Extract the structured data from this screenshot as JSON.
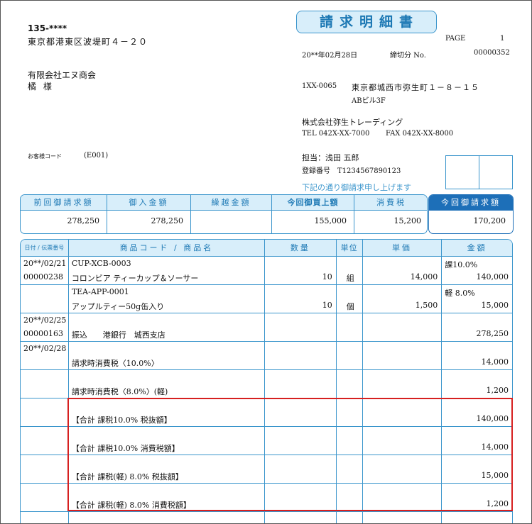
{
  "document": {
    "title": "請求明細書",
    "page_label": "PAGE",
    "page_number": "1",
    "date": "20**年02月28日",
    "cutoff_label": "締切分 No.",
    "doc_no": "00000352"
  },
  "recipient": {
    "postal": "135-****",
    "address": "東京都港東区波堤町４－２０",
    "company": "有限会社エヌ商会",
    "person": "橘 様",
    "customer_code_label": "お客様コード",
    "customer_code": "(E001)"
  },
  "issuer": {
    "postal": "1XX-0065",
    "address1": "東京都城西市弥生町１－８－１５",
    "address2": "ABビル3F",
    "company": "株式会社弥生トレーディング",
    "tel": "TEL 042X-XX-7000",
    "fax": "FAX 042X-XX-8000",
    "staff": "担当：浅田 五郎",
    "registration": "登録番号　T1234567890123",
    "note": "下記の通り御請求申し上げます"
  },
  "summary": {
    "prev_label": "前回御請求額",
    "prev": "278,250",
    "received_label": "御入金額",
    "received": "278,250",
    "carry_label": "繰越金額",
    "carry": "",
    "purchase_label": "今回御買上額",
    "purchase": "155,000",
    "tax_label": "消費税",
    "tax": "15,200",
    "total_label": "今回御請求額",
    "total": "170,200"
  },
  "table": {
    "headers": {
      "date": "日付 / 伝票番号",
      "product": "商品コード / 商品名",
      "qty": "数量",
      "unit": "単位",
      "price": "単価",
      "amount": "金額"
    },
    "rows": [
      {
        "date": "20**/02/21",
        "slip": "00000238",
        "code": "CUP-XCB-0003",
        "name": "コロンビア ティーカップ＆ソーサー",
        "qty": "10",
        "unit": "組",
        "price": "14,000",
        "tax_note": "課10.0%",
        "amount": "140,000"
      },
      {
        "date": "",
        "slip": "",
        "code": "TEA-APP-0001",
        "name": "アップルティー50g缶入り",
        "qty": "10",
        "unit": "個",
        "price": "1,500",
        "tax_note": "軽 8.0%",
        "amount": "15,000"
      },
      {
        "date": "20**/02/25",
        "slip": "00000163",
        "code": "",
        "name": "振込　　港銀行　城西支店",
        "qty": "",
        "unit": "",
        "price": "",
        "tax_note": "",
        "amount": "278,250"
      },
      {
        "date": "20**/02/28",
        "slip": "",
        "code": "",
        "name": "請求時消費税〈10.0%〉",
        "qty": "",
        "unit": "",
        "price": "",
        "tax_note": "",
        "amount": "14,000"
      },
      {
        "date": "",
        "slip": "",
        "code": "",
        "name": "請求時消費税〈8.0%〉(軽)",
        "qty": "",
        "unit": "",
        "price": "",
        "tax_note": "",
        "amount": "1,200"
      },
      {
        "date": "",
        "slip": "",
        "code": "",
        "name": "【合計 課税10.0% 税抜額】",
        "qty": "",
        "unit": "",
        "price": "",
        "tax_note": "",
        "amount": "140,000"
      },
      {
        "date": "",
        "slip": "",
        "code": "",
        "name": "【合計 課税10.0% 消費税額】",
        "qty": "",
        "unit": "",
        "price": "",
        "tax_note": "",
        "amount": "14,000"
      },
      {
        "date": "",
        "slip": "",
        "code": "",
        "name": "【合計 課税(軽) 8.0% 税抜額】",
        "qty": "",
        "unit": "",
        "price": "",
        "tax_note": "",
        "amount": "15,000"
      },
      {
        "date": "",
        "slip": "",
        "code": "",
        "name": "【合計 課税(軽) 8.0% 消費税額】",
        "qty": "",
        "unit": "",
        "price": "",
        "tax_note": "",
        "amount": "1,200"
      }
    ]
  }
}
